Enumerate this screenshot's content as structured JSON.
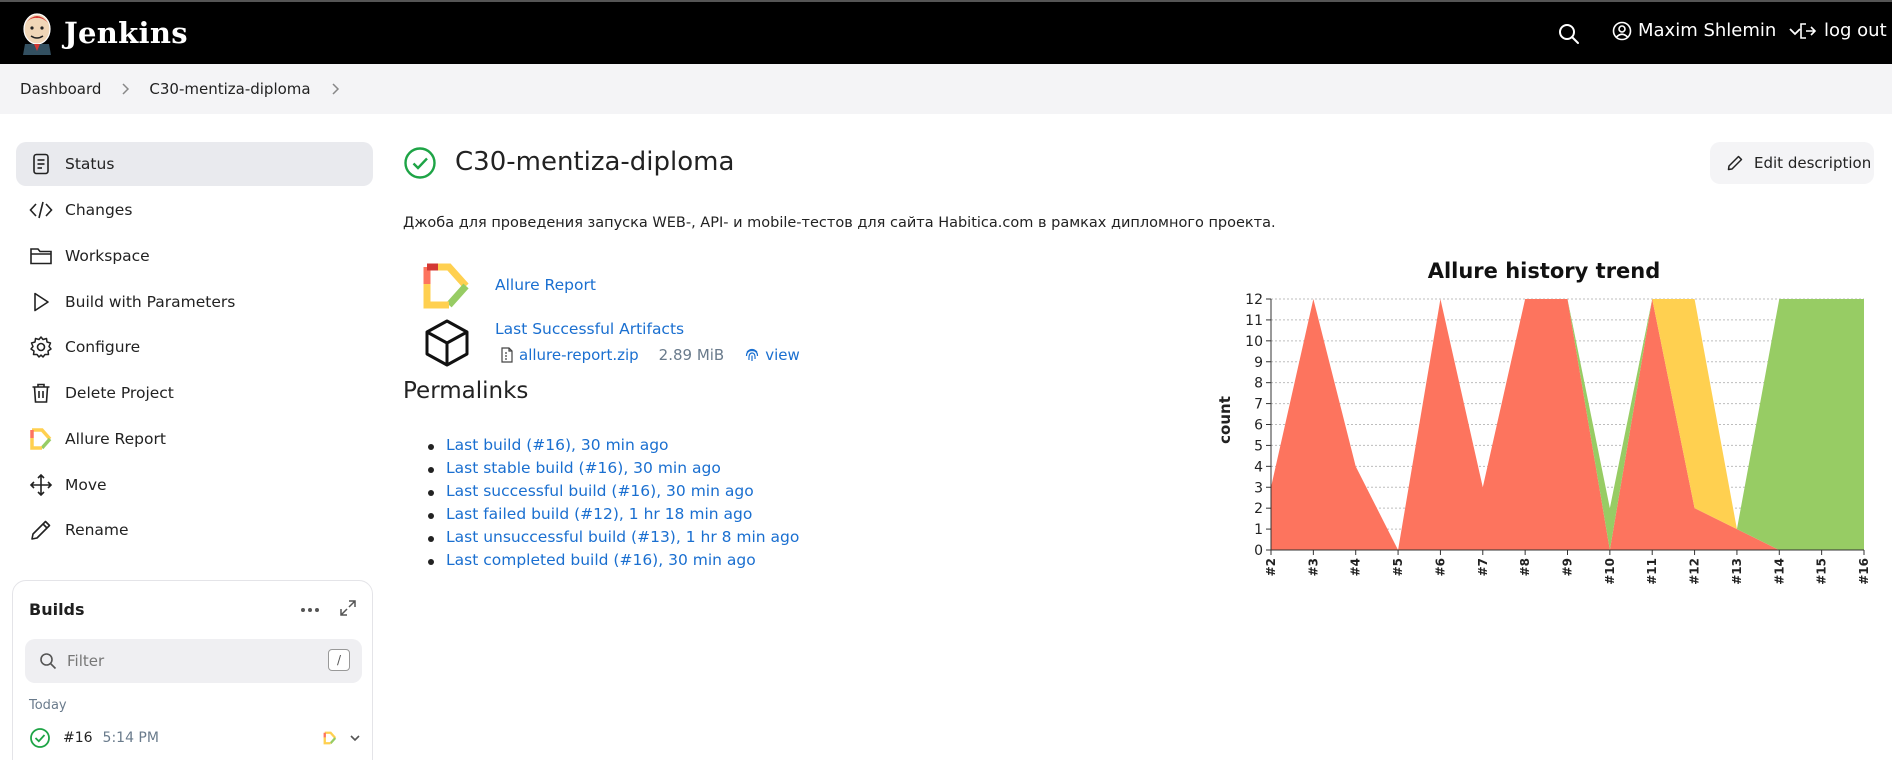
{
  "header": {
    "brand": "Jenkins",
    "user_name": "Maxim Shlemin",
    "logout_label": "log out",
    "icons": [
      "jenkins-logo-icon",
      "search-icon",
      "user-icon",
      "chevron-down-icon",
      "logout-icon"
    ]
  },
  "breadcrumb": [
    "Dashboard",
    "C30-mentiza-diploma"
  ],
  "sidebar": {
    "items": [
      {
        "label": "Status",
        "icon": "status-icon",
        "active": true
      },
      {
        "label": "Changes",
        "icon": "code-icon"
      },
      {
        "label": "Workspace",
        "icon": "folder-icon"
      },
      {
        "label": "Build with Parameters",
        "icon": "play-icon"
      },
      {
        "label": "Configure",
        "icon": "gear-icon"
      },
      {
        "label": "Delete Project",
        "icon": "trash-icon"
      },
      {
        "label": "Allure Report",
        "icon": "allure-icon"
      },
      {
        "label": "Move",
        "icon": "move-icon"
      },
      {
        "label": "Rename",
        "icon": "pencil-icon"
      }
    ]
  },
  "builds": {
    "title": "Builds",
    "filter_placeholder": "Filter",
    "filter_shortcut": "/",
    "group_label": "Today",
    "items": [
      {
        "number": "#16",
        "time": "5:14 PM",
        "status": "success"
      }
    ]
  },
  "job": {
    "title": "C30-mentiza-diploma",
    "edit_description_label": "Edit description",
    "description": "Джоба для проведения запуска WEB-, API- и mobile-тестов для сайта Habitica.com в рамках дипломного проекта.",
    "allure_report_label": "Allure Report",
    "artifacts_label": "Last Successful Artifacts",
    "artifact_file": "allure-report.zip",
    "artifact_size": "2.89 MiB",
    "artifact_view_label": "view"
  },
  "permalinks": {
    "title": "Permalinks",
    "items": [
      "Last build (#16), 30 min ago",
      "Last stable build (#16), 30 min ago",
      "Last successful build (#16), 30 min ago",
      "Last failed build (#12), 1 hr 18 min ago",
      "Last unsuccessful build (#13), 1 hr 8 min ago",
      "Last completed build (#16), 30 min ago"
    ]
  },
  "colors": {
    "failed": "#fd745e",
    "broken": "#ffd050",
    "passed": "#97cc64",
    "link": "#1a6fd0",
    "success_icon": "#1ea446"
  },
  "chart_data": {
    "type": "area",
    "title": "Allure history trend",
    "ylabel": "count",
    "xlabel": "",
    "ylim": [
      0,
      12
    ],
    "yticks": [
      0,
      1,
      2,
      3,
      4,
      5,
      6,
      7,
      8,
      9,
      10,
      11,
      12
    ],
    "grid": true,
    "stacked": true,
    "x": [
      "#2",
      "#3",
      "#4",
      "#5",
      "#6",
      "#7",
      "#8",
      "#9",
      "#10",
      "#11",
      "#12",
      "#13",
      "#14",
      "#15",
      "#16"
    ],
    "series": [
      {
        "name": "",
        "color": "#fd745e",
        "values": [
          3,
          12,
          4,
          0,
          12,
          3,
          12,
          12,
          0,
          12,
          2,
          1,
          0,
          0,
          0
        ]
      },
      {
        "name": "",
        "color": "#ffd050",
        "values": [
          0,
          0,
          0,
          0,
          0,
          0,
          0,
          0,
          0,
          0,
          10,
          0,
          0,
          0,
          0
        ]
      },
      {
        "name": "",
        "color": "#97cc64",
        "values": [
          0,
          0,
          0,
          0,
          0,
          0,
          0,
          0,
          2,
          0,
          0,
          0,
          12,
          12,
          12
        ]
      }
    ]
  }
}
